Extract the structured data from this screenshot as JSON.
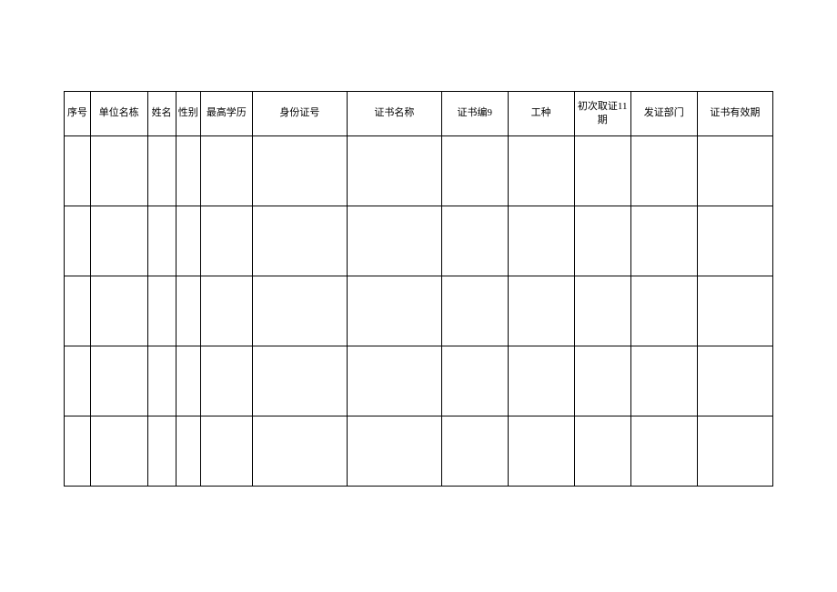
{
  "chart_data": {
    "type": "table",
    "headers": [
      "序号",
      "单位名栋",
      "姓名",
      "性别",
      "最高学历",
      "身份证号",
      "证书名称",
      "证书编9",
      "工种",
      "初次取证11期",
      "发证部门",
      "证书有效期"
    ],
    "rows": [
      [
        "",
        "",
        "",
        "",
        "",
        "",
        "",
        "",
        "",
        "",
        "",
        ""
      ],
      [
        "",
        "",
        "",
        "",
        "",
        "",
        "",
        "",
        "",
        "",
        "",
        ""
      ],
      [
        "",
        "",
        "",
        "",
        "",
        "",
        "",
        "",
        "",
        "",
        "",
        ""
      ],
      [
        "",
        "",
        "",
        "",
        "",
        "",
        "",
        "",
        "",
        "",
        "",
        ""
      ],
      [
        "",
        "",
        "",
        "",
        "",
        "",
        "",
        "",
        "",
        "",
        "",
        ""
      ]
    ]
  }
}
